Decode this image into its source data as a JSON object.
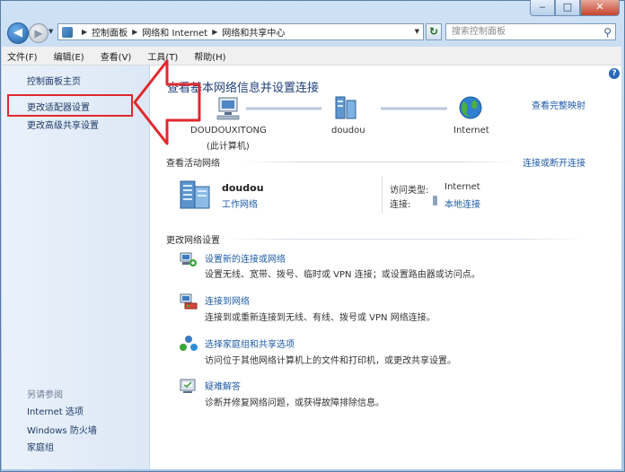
{
  "breadcrumb": [
    "控制面板",
    "网络和 Internet",
    "网络和共享中心"
  ],
  "search": {
    "placeholder": "搜索控制面板"
  },
  "menu": [
    "文件(F)",
    "编辑(E)",
    "查看(V)",
    "工具(T)",
    "帮助(H)"
  ],
  "sidebar": {
    "items": [
      "控制面板主页",
      "更改适配器设置",
      "更改高级共享设置"
    ],
    "see_also_title": "另请参阅",
    "see_also": [
      "Internet 选项",
      "Windows 防火墙",
      "家庭组"
    ]
  },
  "main": {
    "title": "查看基本网络信息并设置连接",
    "view_full_map": "查看完整映射",
    "map": {
      "computer_name": "DOUDOUXITONG",
      "computer_sub": "(此计算机)",
      "network_name": "doudou",
      "internet": "Internet"
    },
    "active_header": "查看活动网络",
    "connect_disconnect": "连接或断开连接",
    "active": {
      "name": "doudou",
      "type": "工作网络",
      "access_label": "访问类型:",
      "access_value": "Internet",
      "conn_label": "连接:",
      "conn_value": "本地连接"
    },
    "change_header": "更改网络设置",
    "tasks": [
      {
        "title": "设置新的连接或网络",
        "desc": "设置无线、宽带、拨号、临时或 VPN 连接；或设置路由器或访问点。"
      },
      {
        "title": "连接到网络",
        "desc": "连接到或重新连接到无线、有线、拨号或 VPN 网络连接。"
      },
      {
        "title": "选择家庭组和共享选项",
        "desc": "访问位于其他网络计算机上的文件和打印机，或更改共享设置。"
      },
      {
        "title": "疑难解答",
        "desc": "诊断并修复网络问题，或获得故障排除信息。"
      }
    ]
  },
  "colors": {
    "highlight_box": "#e0282d",
    "link": "#1e5ba6"
  }
}
